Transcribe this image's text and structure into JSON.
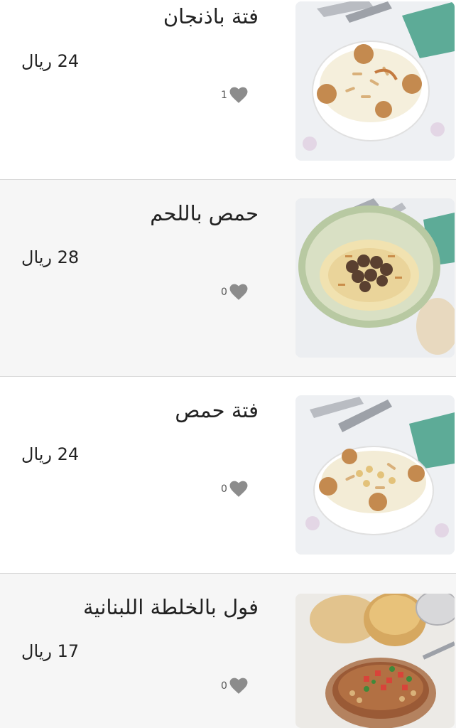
{
  "items": [
    {
      "title": "فتة باذنجان",
      "price": "24 ريال",
      "likes": "1",
      "thumb_icon": "fatteh-eggplant-dish-image"
    },
    {
      "title": "حمص باللحم",
      "price": "28 ريال",
      "likes": "0",
      "thumb_icon": "hummus-with-meat-dish-image"
    },
    {
      "title": "فتة حمص",
      "price": "24 ريال",
      "likes": "0",
      "thumb_icon": "fatteh-hummus-dish-image"
    },
    {
      "title": "فول بالخلطة اللبنانية",
      "price": "17 ريال",
      "likes": "0",
      "thumb_icon": "foul-lebanese-dish-image"
    }
  ],
  "colors": {
    "row_shaded": "#f6f6f6",
    "divider": "#d9d9d9",
    "heart": "#8c8c8c",
    "text": "#222222"
  }
}
